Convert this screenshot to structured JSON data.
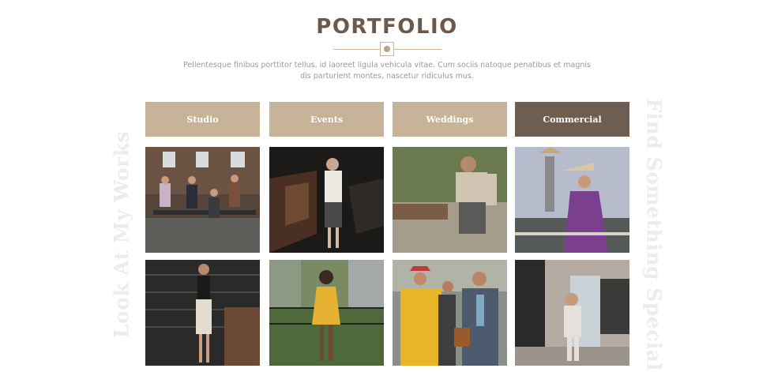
{
  "header": {
    "title": "PORTFOLIO",
    "subtitle": "Pellentesque finibus porttitor tellus, id laoreet ligula vehicula vitae. Cum sociis natoque penatibus et magnis dis parturient montes, nascetur ridiculus mus."
  },
  "side_text": {
    "left": "Look At My Works",
    "right": "Find Something Special"
  },
  "tabs": [
    {
      "label": "Studio"
    },
    {
      "label": "Events"
    },
    {
      "label": "Weddings"
    },
    {
      "label": "Commercial",
      "active": true
    }
  ],
  "colors": {
    "tab": "#c7b397",
    "tab_active": "#6e5e52",
    "title": "#6b5a4c",
    "side_text": "#ececec"
  }
}
